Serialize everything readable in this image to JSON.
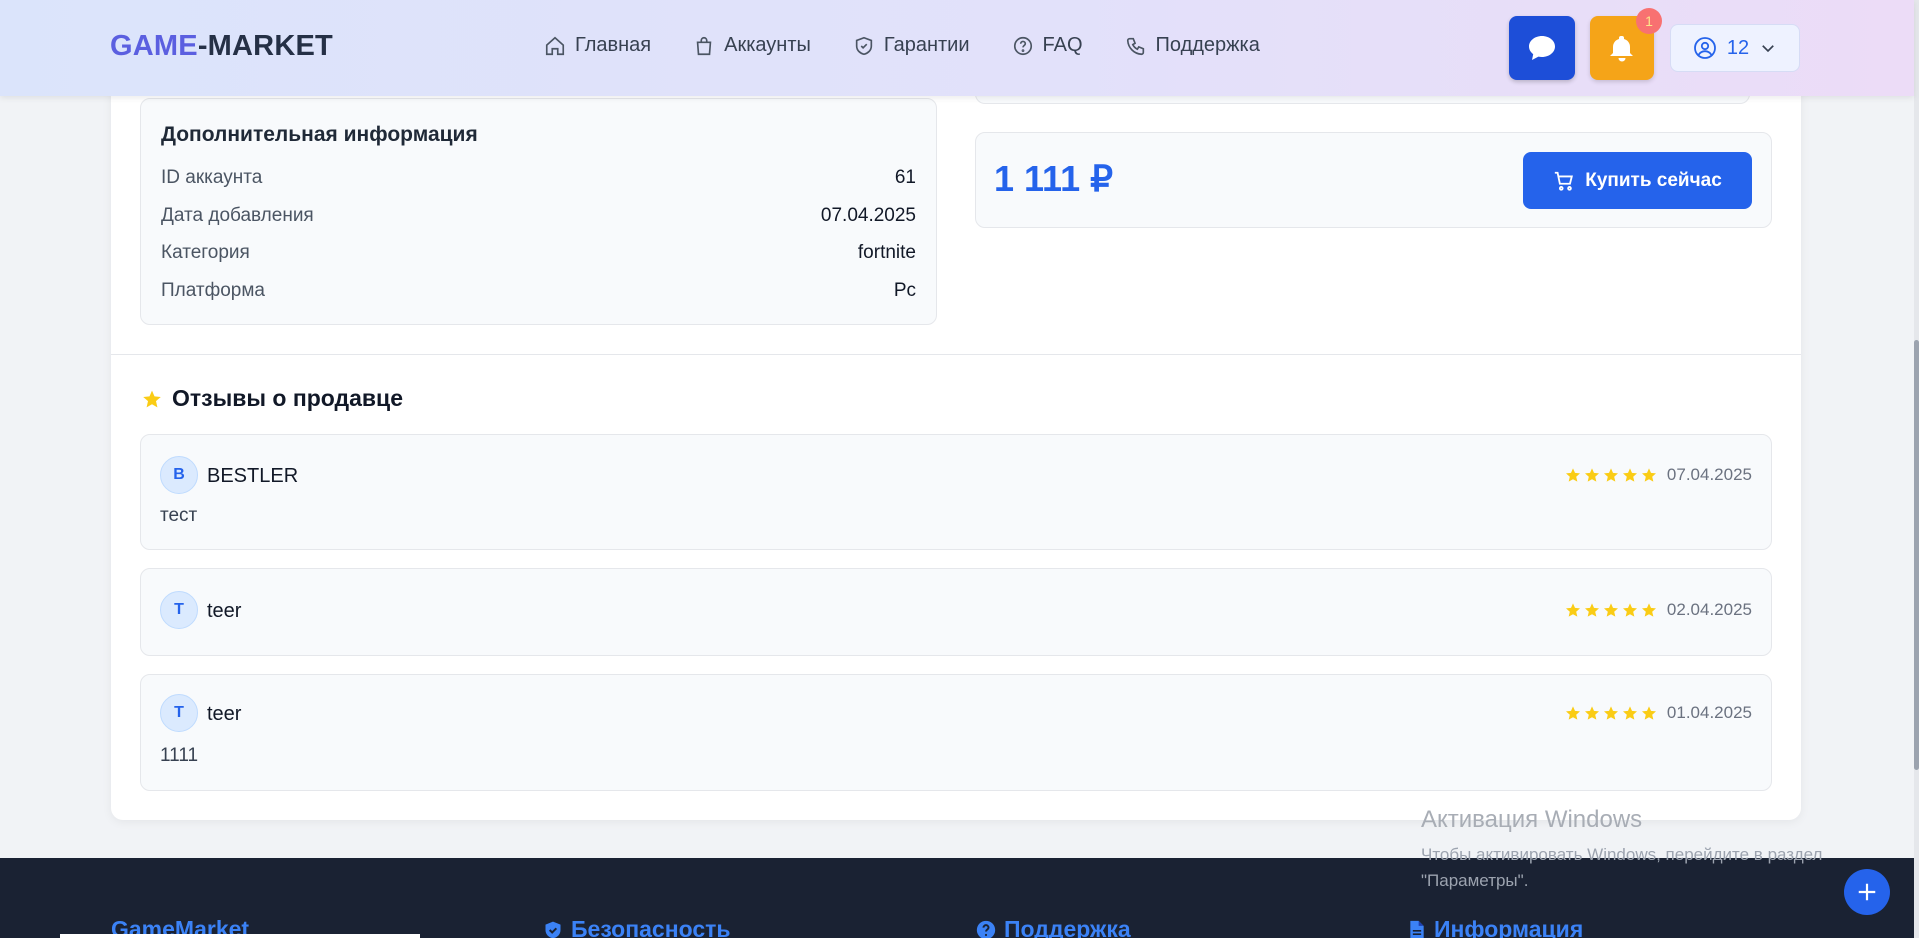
{
  "header": {
    "logo_part1": "GAME",
    "logo_part2": "-MARKET",
    "nav": [
      {
        "label": "Главная",
        "icon": "home-icon"
      },
      {
        "label": "Аккаунты",
        "icon": "bag-icon"
      },
      {
        "label": "Гарантии",
        "icon": "shield-icon"
      },
      {
        "label": "FAQ",
        "icon": "question-icon"
      },
      {
        "label": "Поддержка",
        "icon": "phone-icon"
      }
    ],
    "notification_count": "1",
    "user_label": "12"
  },
  "info": {
    "title": "Дополнительная информация",
    "rows": [
      {
        "key": "ID аккаунта",
        "value": "61"
      },
      {
        "key": "Дата добавления",
        "value": "07.04.2025"
      },
      {
        "key": "Категория",
        "value": "fortnite"
      },
      {
        "key": "Платформа",
        "value": "Pc"
      }
    ]
  },
  "purchase": {
    "price": "1 111 ₽",
    "buy_label": "Купить сейчас"
  },
  "reviews": {
    "title": "Отзывы о продавце",
    "items": [
      {
        "initial": "B",
        "name": "BESTLER",
        "text": "тест",
        "rating": 5,
        "date": "07.04.2025"
      },
      {
        "initial": "T",
        "name": "teer",
        "text": "",
        "rating": 5,
        "date": "02.04.2025"
      },
      {
        "initial": "T",
        "name": "teer",
        "text": "1111",
        "rating": 5,
        "date": "01.04.2025"
      }
    ]
  },
  "footer": {
    "columns": [
      {
        "label": "GameMarket",
        "icon": ""
      },
      {
        "label": "Безопасность",
        "icon": "shield-check-icon"
      },
      {
        "label": "Поддержка",
        "icon": "question-circle-icon"
      },
      {
        "label": "Информация",
        "icon": "document-icon"
      }
    ]
  },
  "windows_watermark": {
    "title": "Активация Windows",
    "line1": "Чтобы активировать Windows, перейдите в раздел",
    "line2": "\"Параметры\"."
  },
  "colors": {
    "accent": "#2563eb",
    "bell": "#f5a418",
    "star": "#facc15",
    "footer_bg": "#1a2233"
  }
}
